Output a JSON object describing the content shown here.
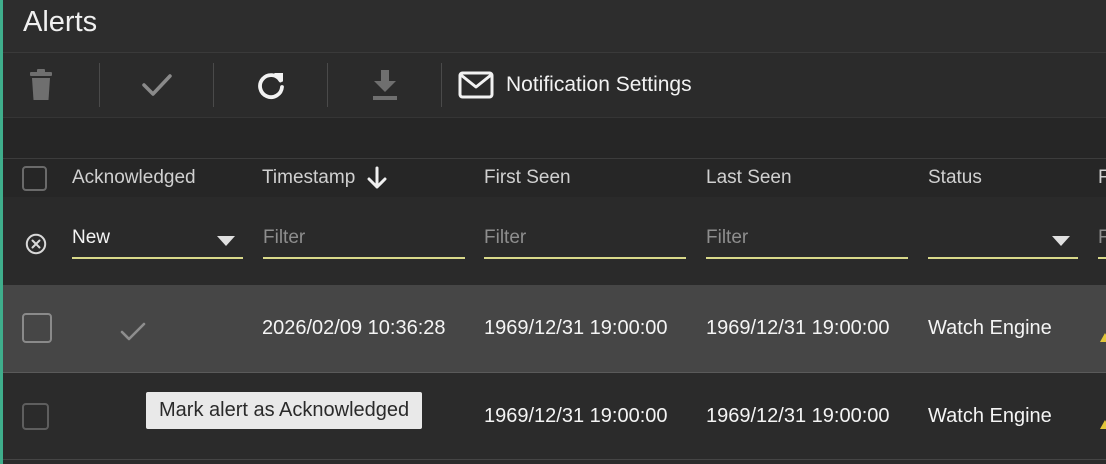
{
  "app": {
    "title": "Alerts"
  },
  "toolbar": {
    "notification_label": "Notification Settings",
    "icons": [
      "trash-icon",
      "check-icon",
      "refresh-icon",
      "download-icon",
      "envelope-icon"
    ]
  },
  "table": {
    "columns": [
      "Acknowledged",
      "Timestamp",
      "First Seen",
      "Last Seen",
      "Status",
      "F"
    ],
    "sort_icon": "arrow-down-icon",
    "filters": {
      "acknowledged_value": "New",
      "timestamp_placeholder": "Filter",
      "first_seen_placeholder": "Filter",
      "last_seen_placeholder": "Filter",
      "status_value": "",
      "extra_placeholder": "F"
    },
    "rows": [
      {
        "timestamp": "2026/02/09 10:36:28",
        "first_seen": "1969/12/31 19:00:00",
        "last_seen": "1969/12/31 19:00:00",
        "status": "Watch Engine"
      },
      {
        "timestamp": "",
        "first_seen": "1969/12/31 19:00:00",
        "last_seen": "1969/12/31 19:00:00",
        "status": "Watch Engine"
      }
    ]
  },
  "tooltip": {
    "text": "Mark alert as Acknowledged"
  },
  "colors": {
    "accent_underline": "#d9d98a",
    "edge": "#3fae8c",
    "warning": "#e2c63a"
  }
}
